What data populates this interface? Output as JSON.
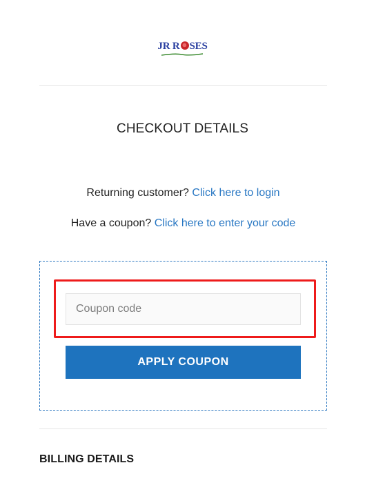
{
  "logo": {
    "text_before": "JR R",
    "text_after": "SES"
  },
  "header": {
    "title": "CHECKOUT DETAILS"
  },
  "notices": {
    "login_prefix": "Returning customer?",
    "login_link": "Click here to login",
    "coupon_prefix": "Have a coupon?",
    "coupon_link": "Click here to enter your code"
  },
  "coupon": {
    "input_placeholder": "Coupon code",
    "input_value": "",
    "apply_label": "APPLY COUPON"
  },
  "billing": {
    "heading": "BILLING DETAILS"
  },
  "colors": {
    "link": "#2877c3",
    "button": "#1e73be",
    "highlight": "#ee1b1b",
    "dashed_border": "#2c77c0"
  }
}
